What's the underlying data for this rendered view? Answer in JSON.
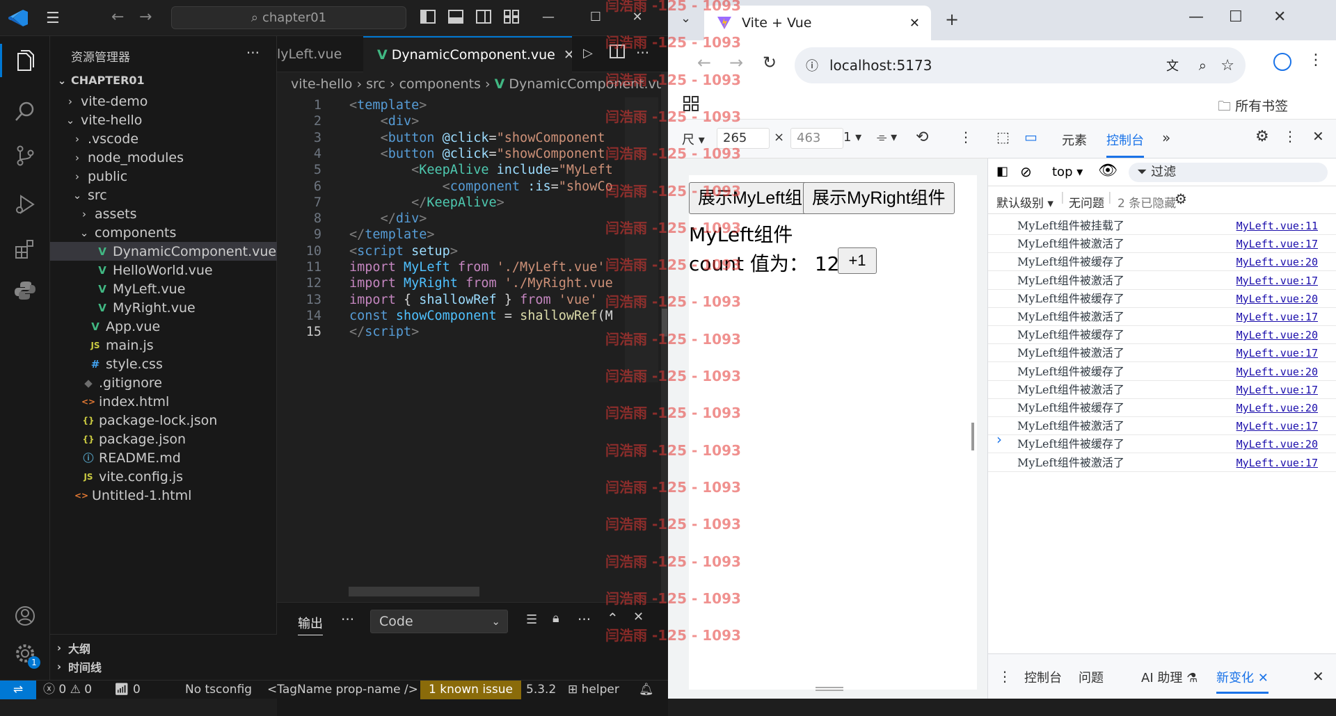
{
  "vscode": {
    "search_text": "chapter01",
    "explorer_title": "资源管理器",
    "explorer_more": "···",
    "root_folder": "CHAPTER01",
    "tree": [
      {
        "label": "vite-demo",
        "type": "folder",
        "collapsed": true,
        "depth": 1
      },
      {
        "label": "vite-hello",
        "type": "folder",
        "collapsed": false,
        "depth": 1
      },
      {
        "label": ".vscode",
        "type": "folder",
        "collapsed": true,
        "depth": 2
      },
      {
        "label": "node_modules",
        "type": "folder",
        "collapsed": true,
        "depth": 2
      },
      {
        "label": "public",
        "type": "folder",
        "collapsed": true,
        "depth": 2
      },
      {
        "label": "src",
        "type": "folder",
        "collapsed": false,
        "depth": 2
      },
      {
        "label": "assets",
        "type": "folder",
        "collapsed": true,
        "depth": 3
      },
      {
        "label": "components",
        "type": "folder",
        "collapsed": false,
        "depth": 3
      },
      {
        "label": "DynamicComponent.vue",
        "type": "vue",
        "depth": 4,
        "selected": true
      },
      {
        "label": "HelloWorld.vue",
        "type": "vue",
        "depth": 4
      },
      {
        "label": "MyLeft.vue",
        "type": "vue",
        "depth": 4
      },
      {
        "label": "MyRight.vue",
        "type": "vue",
        "depth": 4
      },
      {
        "label": "App.vue",
        "type": "vue",
        "depth": 3
      },
      {
        "label": "main.js",
        "type": "js",
        "depth": 3
      },
      {
        "label": "style.css",
        "type": "css",
        "depth": 3
      },
      {
        "label": ".gitignore",
        "type": "git",
        "depth": 2
      },
      {
        "label": "index.html",
        "type": "html",
        "depth": 2
      },
      {
        "label": "package-lock.json",
        "type": "json",
        "depth": 2
      },
      {
        "label": "package.json",
        "type": "json",
        "depth": 2
      },
      {
        "label": "README.md",
        "type": "info",
        "depth": 2
      },
      {
        "label": "vite.config.js",
        "type": "js",
        "depth": 2
      },
      {
        "label": "Untitled-1.html",
        "type": "html",
        "depth": 1
      }
    ],
    "outline_label": "大纲",
    "timeline_label": "时间线",
    "tabs": [
      {
        "label": "lyLeft.vue",
        "active": false
      },
      {
        "label": "DynamicComponent.vue",
        "active": true
      }
    ],
    "tab_more": "···",
    "breadcrumb": [
      "vite-hello",
      "src",
      "components",
      "DynamicComponent.vue"
    ],
    "code_lines": [
      {
        "n": "1",
        "tokens": [
          [
            "t-pun",
            "<"
          ],
          [
            "t-tag",
            "template"
          ],
          [
            "t-pun",
            ">"
          ]
        ]
      },
      {
        "n": "2",
        "tokens": [
          [
            "t-plain",
            "    "
          ],
          [
            "t-pun",
            "<"
          ],
          [
            "t-tag",
            "div"
          ],
          [
            "t-pun",
            ">"
          ]
        ]
      },
      {
        "n": "3",
        "tokens": [
          [
            "t-plain",
            "    "
          ],
          [
            "t-pun",
            "<"
          ],
          [
            "t-tag",
            "button"
          ],
          [
            "t-plain",
            " "
          ],
          [
            "t-attr",
            "@click"
          ],
          [
            "t-plain",
            "="
          ],
          [
            "t-str",
            "\"showComponent"
          ]
        ]
      },
      {
        "n": "4",
        "tokens": [
          [
            "t-plain",
            "    "
          ],
          [
            "t-pun",
            "<"
          ],
          [
            "t-tag",
            "button"
          ],
          [
            "t-plain",
            " "
          ],
          [
            "t-attr",
            "@click"
          ],
          [
            "t-plain",
            "="
          ],
          [
            "t-str",
            "\"showComponent"
          ]
        ]
      },
      {
        "n": "5",
        "tokens": [
          [
            "t-plain",
            "        "
          ],
          [
            "t-pun",
            "<"
          ],
          [
            "t-comp",
            "KeepAlive"
          ],
          [
            "t-plain",
            " "
          ],
          [
            "t-attr",
            "include"
          ],
          [
            "t-plain",
            "="
          ],
          [
            "t-str",
            "\"MyLeft"
          ]
        ]
      },
      {
        "n": "6",
        "tokens": [
          [
            "t-plain",
            "            "
          ],
          [
            "t-pun",
            "<"
          ],
          [
            "t-tag",
            "component"
          ],
          [
            "t-plain",
            " "
          ],
          [
            "t-attr",
            ":is"
          ],
          [
            "t-plain",
            "="
          ],
          [
            "t-str",
            "\"showCo"
          ]
        ]
      },
      {
        "n": "7",
        "tokens": [
          [
            "t-plain",
            "        "
          ],
          [
            "t-pun",
            "</"
          ],
          [
            "t-comp",
            "KeepAlive"
          ],
          [
            "t-pun",
            ">"
          ]
        ]
      },
      {
        "n": "8",
        "tokens": [
          [
            "t-plain",
            "    "
          ],
          [
            "t-pun",
            "</"
          ],
          [
            "t-tag",
            "div"
          ],
          [
            "t-pun",
            ">"
          ]
        ]
      },
      {
        "n": "9",
        "tokens": [
          [
            "t-pun",
            "</"
          ],
          [
            "t-tag",
            "template"
          ],
          [
            "t-pun",
            ">"
          ]
        ]
      },
      {
        "n": "10",
        "tokens": [
          [
            "t-pun",
            "<"
          ],
          [
            "t-tag",
            "script"
          ],
          [
            "t-plain",
            " "
          ],
          [
            "t-attr",
            "setup"
          ],
          [
            "t-pun",
            ">"
          ]
        ]
      },
      {
        "n": "11",
        "tokens": [
          [
            "t-kw",
            "import"
          ],
          [
            "t-plain",
            " "
          ],
          [
            "t-var",
            "MyLeft"
          ],
          [
            "t-plain",
            " "
          ],
          [
            "t-kw",
            "from"
          ],
          [
            "t-plain",
            " "
          ],
          [
            "t-str",
            "'./MyLeft.vue'"
          ]
        ]
      },
      {
        "n": "12",
        "tokens": [
          [
            "t-kw",
            "import"
          ],
          [
            "t-plain",
            " "
          ],
          [
            "t-var",
            "MyRight"
          ],
          [
            "t-plain",
            " "
          ],
          [
            "t-kw",
            "from"
          ],
          [
            "t-plain",
            " "
          ],
          [
            "t-str",
            "'./MyRight.vue"
          ]
        ]
      },
      {
        "n": "13",
        "tokens": [
          [
            "t-kw",
            "import"
          ],
          [
            "t-plain",
            " { "
          ],
          [
            "t-attr",
            "shallowRef"
          ],
          [
            "t-plain",
            " } "
          ],
          [
            "t-kw",
            "from"
          ],
          [
            "t-plain",
            " "
          ],
          [
            "t-str",
            "'vue'"
          ]
        ]
      },
      {
        "n": "14",
        "tokens": [
          [
            "t-blue",
            "const"
          ],
          [
            "t-plain",
            " "
          ],
          [
            "t-var",
            "showComponent"
          ],
          [
            "t-plain",
            " = "
          ],
          [
            "t-func",
            "shallowRef"
          ],
          [
            "t-plain",
            "(M"
          ]
        ]
      },
      {
        "n": "15",
        "tokens": [
          [
            "t-pun",
            "</"
          ],
          [
            "t-tag",
            "script"
          ],
          [
            "t-pun",
            ">"
          ]
        ]
      }
    ],
    "current_line": "15",
    "panel_tab": "输出",
    "panel_more": "···",
    "panel_dropdown": "Code",
    "status": {
      "errors": "0",
      "warnings": "0",
      "ports": "0",
      "tsconfig": "No tsconfig",
      "tagname": "<TagName prop-name />",
      "issue": "1 known issue",
      "version": "5.3.2",
      "helper": "helper"
    },
    "accounts_badge": "1"
  },
  "browser": {
    "tab_title": "Vite + Vue",
    "url": "localhost:5173",
    "bookmarks_label": "所有书签",
    "device_width": "265",
    "device_height": "463",
    "device_x": "×",
    "device_scale": "1",
    "device_mode": "尺",
    "page": {
      "btn_left": "展示MyLeft组件",
      "btn_right": "展示MyRight组件",
      "component_title": "MyLeft组件",
      "count_label": "count 值为：",
      "count_value": "12",
      "inc_button": "+1"
    },
    "devtools": {
      "tab_elements": "元素",
      "tab_console": "控制台",
      "context": "top",
      "filter_placeholder": "过滤",
      "level": "默认级别",
      "no_issues": "无问题",
      "hidden": "2 条已隐藏",
      "logs": [
        {
          "msg": "MyLeft组件被挂载了",
          "src": "MyLeft.vue:11"
        },
        {
          "msg": "MyLeft组件被激活了",
          "src": "MyLeft.vue:17"
        },
        {
          "msg": "MyLeft组件被缓存了",
          "src": "MyLeft.vue:20"
        },
        {
          "msg": "MyLeft组件被激活了",
          "src": "MyLeft.vue:17"
        },
        {
          "msg": "MyLeft组件被缓存了",
          "src": "MyLeft.vue:20"
        },
        {
          "msg": "MyLeft组件被激活了",
          "src": "MyLeft.vue:17"
        },
        {
          "msg": "MyLeft组件被缓存了",
          "src": "MyLeft.vue:20"
        },
        {
          "msg": "MyLeft组件被激活了",
          "src": "MyLeft.vue:17"
        },
        {
          "msg": "MyLeft组件被缓存了",
          "src": "MyLeft.vue:20"
        },
        {
          "msg": "MyLeft组件被激活了",
          "src": "MyLeft.vue:17"
        },
        {
          "msg": "MyLeft组件被缓存了",
          "src": "MyLeft.vue:20"
        },
        {
          "msg": "MyLeft组件被激活了",
          "src": "MyLeft.vue:17"
        },
        {
          "msg": "MyLeft组件被缓存了",
          "src": "MyLeft.vue:20"
        },
        {
          "msg": "MyLeft组件被激活了",
          "src": "MyLeft.vue:17"
        }
      ],
      "prompt": "›",
      "drawer_tabs": [
        "控制台",
        "问题",
        "AI 助理",
        "新变化"
      ]
    }
  },
  "watermark": "闫浩雨 -125 - 1093",
  "colors": {
    "accent": "#0078d4",
    "vue_green": "#41b883",
    "js_yellow": "#cbcb41",
    "css_blue": "#42a5f5",
    "html_orange": "#e37933",
    "watermark": "#e53935"
  }
}
